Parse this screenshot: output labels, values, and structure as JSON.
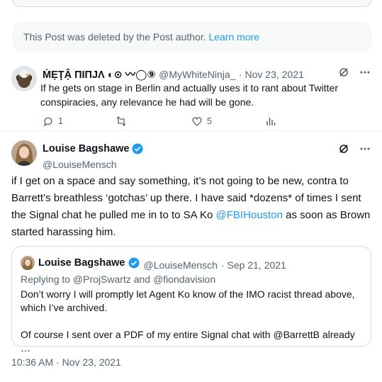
{
  "deleted_notice": {
    "text": "This Post was deleted by the Post author.",
    "link": "Learn more"
  },
  "reply": {
    "name": "ṀẸŢẬ ПIПJΛ ◐⊙ 〰◯⑨",
    "handle": "@MyWhiteNinja_",
    "time": "· Nov 23, 2021",
    "body": "If he gets on stage in Berlin and actually uses it to rant about Twitter conspiracies, any relevance he had will be gone.",
    "replies": "1",
    "likes": "5"
  },
  "main": {
    "name": "Louise Bagshawe",
    "handle": "@LouiseMensch",
    "text_parts": {
      "pre": "if I get on a space and say something, it’s not going to be new, contra to Barrett’s breathless ‘gotchas’ up there. I have said *dozens* of times I sent the Signal chat he pulled me in to to SA Ko ",
      "mention": "@FBIHouston",
      "post": " as soon as Brown started harassing him."
    },
    "timestamp": "10:36 AM · Nov 23, 2021"
  },
  "quote": {
    "name": "Louise Bagshawe",
    "handle": "@LouiseMensch",
    "time": "· Sep 21, 2021",
    "replying": "Replying to @ProjSwartz and @fiondavision",
    "line1": "Don’t worry I will promptly let Agent Ko know of the IMO racist thread above, which I’ve archived.",
    "line2": "Of course I sent over a PDF of my entire Signal chat with @BarrettB already …"
  },
  "colors": {
    "accent": "#1d9bf0",
    "muted": "#536471",
    "verified": "#1d9bf0"
  }
}
